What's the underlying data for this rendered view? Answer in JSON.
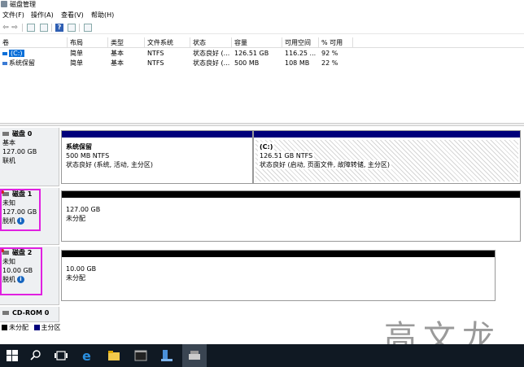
{
  "window": {
    "title": "磁盘管理"
  },
  "menu": [
    {
      "label": "文件(F)"
    },
    {
      "label": "操作(A)"
    },
    {
      "label": "查看(V)"
    },
    {
      "label": "帮助(H)"
    }
  ],
  "volume_table": {
    "headers": [
      "卷",
      "布局",
      "类型",
      "文件系统",
      "状态",
      "容量",
      "可用空间",
      "% 可用"
    ],
    "rows": [
      {
        "volume": "(C:)",
        "layout": "简单",
        "type": "基本",
        "fs": "NTFS",
        "status": "状态良好 (...",
        "capacity": "126.51 GB",
        "free": "116.25 ...",
        "pct": "92 %"
      },
      {
        "volume": "系统保留",
        "layout": "简单",
        "type": "基本",
        "fs": "NTFS",
        "status": "状态良好 (...",
        "capacity": "500 MB",
        "free": "108 MB",
        "pct": "22 %"
      }
    ]
  },
  "disks": {
    "disk0": {
      "name": "磁盘 0",
      "type": "基本",
      "size": "127.00 GB",
      "state": "联机",
      "partitions": [
        {
          "name": "系统保留",
          "size": "500 MB NTFS",
          "status": "状态良好 (系统, 活动, 主分区)"
        },
        {
          "name": "(C:)",
          "size": "126.51 GB NTFS",
          "status": "状态良好 (启动, 页面文件, 故障转储, 主分区)"
        }
      ]
    },
    "disk1": {
      "name": "磁盘 1",
      "type": "未知",
      "size": "127.00 GB",
      "state": "脱机",
      "part_size": "127.00 GB",
      "part_status": "未分配"
    },
    "disk2": {
      "name": "磁盘 2",
      "type": "未知",
      "size": "10.00 GB",
      "state": "脱机",
      "part_size": "10.00 GB",
      "part_status": "未分配"
    },
    "cdrom": {
      "name": "CD-ROM 0"
    }
  },
  "legend": {
    "unallocated": "未分配",
    "primary": "主分区"
  },
  "watermark": "高文龙",
  "colors": {
    "primary_bar": "#00007b",
    "unallocated_bar": "#000000",
    "highlight": "#e020e0",
    "taskbar": "#101923"
  }
}
